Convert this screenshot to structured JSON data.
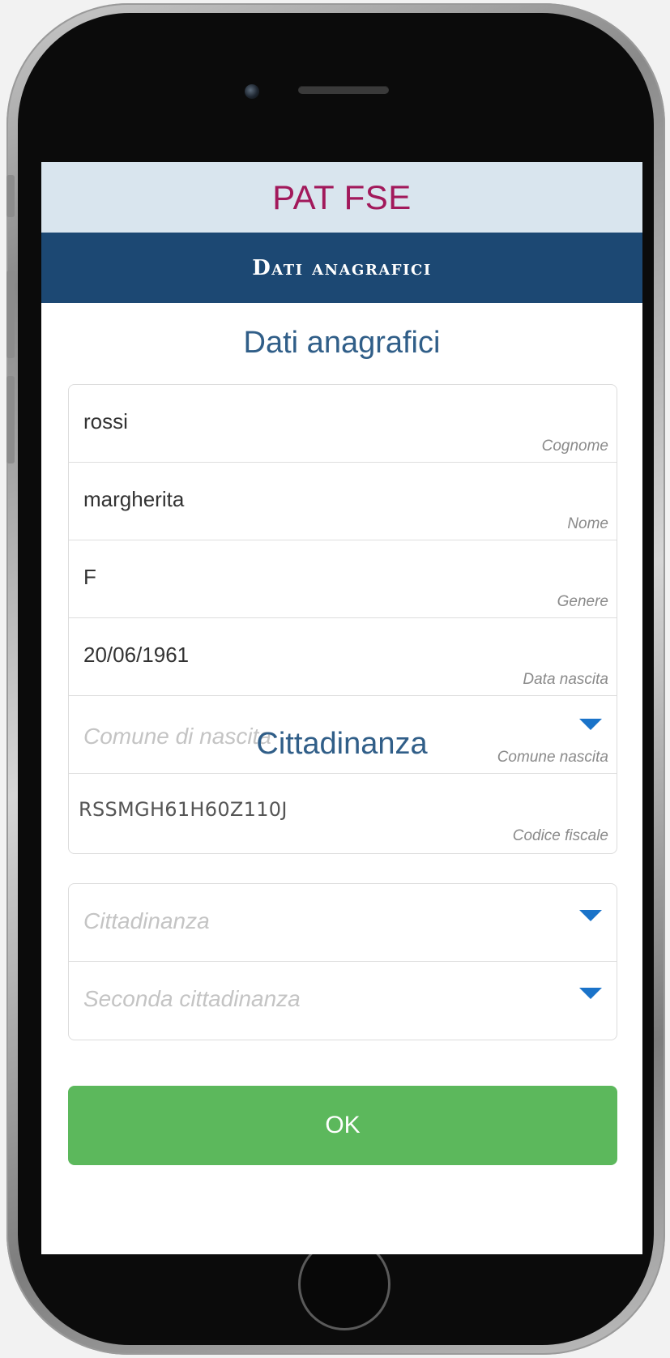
{
  "app": {
    "title": "PAT FSE"
  },
  "nav": {
    "title": "Dati anagrafici"
  },
  "personal": {
    "section_title": "Dati anagrafici",
    "fields": [
      {
        "value": "rossi",
        "label": "Cognome"
      },
      {
        "value": "margherita",
        "label": "Nome"
      },
      {
        "value": "F",
        "label": "Genere"
      },
      {
        "value": "20/06/1961",
        "label": "Data nascita"
      },
      {
        "placeholder": "Comune di nascita",
        "label": "Comune  nascita"
      },
      {
        "value": "RSSMGH61H60Z110J",
        "label": "Codice fiscale"
      }
    ]
  },
  "citizenship": {
    "section_title": "Cittadinanza",
    "fields": [
      {
        "placeholder": "Cittadinanza"
      },
      {
        "placeholder": "Seconda cittadinanza"
      }
    ]
  },
  "actions": {
    "ok_label": "OK"
  },
  "colors": {
    "brand": "#a2195b",
    "nav_bg": "#1c4873",
    "header_bg": "#d9e5ee",
    "section_title": "#305e88",
    "ok_button": "#5cb85c",
    "dropdown_arrow": "#1a73c9"
  },
  "icons": {
    "dropdown": "caret-down-icon"
  }
}
